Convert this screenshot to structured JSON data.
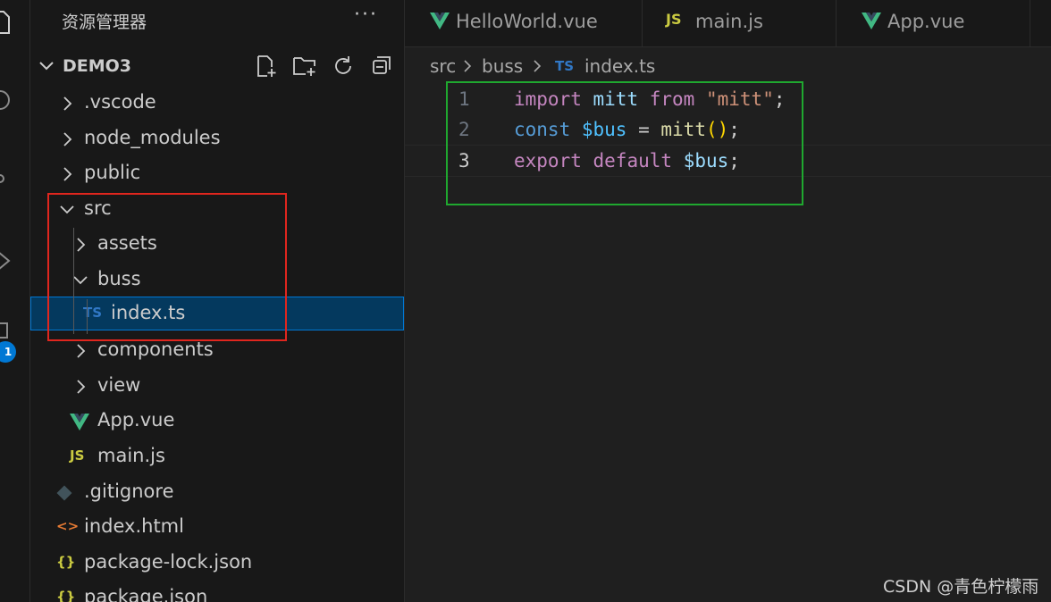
{
  "sidebar": {
    "title": "资源管理器",
    "more_icon": "ellipsis-icon",
    "section": {
      "name": "DEMO3",
      "actions": [
        "new-file-icon",
        "new-folder-icon",
        "refresh-icon",
        "collapse-all-icon"
      ]
    },
    "tree": [
      {
        "label": ".vscode",
        "type": "folder",
        "expanded": false,
        "depth": 0
      },
      {
        "label": "node_modules",
        "type": "folder",
        "expanded": false,
        "depth": 0
      },
      {
        "label": "public",
        "type": "folder",
        "expanded": false,
        "depth": 0
      },
      {
        "label": "src",
        "type": "folder",
        "expanded": true,
        "depth": 0
      },
      {
        "label": "assets",
        "type": "folder",
        "expanded": false,
        "depth": 1
      },
      {
        "label": "buss",
        "type": "folder",
        "expanded": true,
        "depth": 1
      },
      {
        "label": "index.ts",
        "type": "ts",
        "icon_text": "TS",
        "depth": 2,
        "selected": true
      },
      {
        "label": "components",
        "type": "folder",
        "expanded": false,
        "depth": 1
      },
      {
        "label": "view",
        "type": "folder",
        "expanded": false,
        "depth": 1
      },
      {
        "label": "App.vue",
        "type": "vue",
        "depth": 1
      },
      {
        "label": "main.js",
        "type": "js",
        "icon_text": "JS",
        "depth": 1
      },
      {
        "label": ".gitignore",
        "type": "git",
        "depth": 0
      },
      {
        "label": "index.html",
        "type": "html",
        "icon_text": "<>",
        "depth": 0
      },
      {
        "label": "package-lock.json",
        "type": "json",
        "icon_text": "{}",
        "depth": 0
      },
      {
        "label": "package.json",
        "type": "json",
        "icon_text": "{}",
        "depth": 0
      }
    ]
  },
  "activity_bar": {
    "icons": [
      "files-icon",
      "search-icon",
      "source-control-icon",
      "run-debug-icon",
      "extensions-icon"
    ],
    "badge": "1"
  },
  "tabs": [
    {
      "label": "HelloWorld.vue",
      "icon": "vue-icon"
    },
    {
      "label": "main.js",
      "icon": "js-icon",
      "icon_text": "JS"
    },
    {
      "label": "App.vue",
      "icon": "vue-icon"
    }
  ],
  "breadcrumb": {
    "parts": [
      "src",
      "buss"
    ],
    "file_icon_text": "TS",
    "file": "index.ts"
  },
  "editor": {
    "lines": [
      {
        "number": "1",
        "tokens": [
          [
            "import",
            "kw"
          ],
          [
            " ",
            ""
          ],
          [
            "mitt",
            "var"
          ],
          [
            " ",
            ""
          ],
          [
            "from",
            "kw"
          ],
          [
            " ",
            ""
          ],
          [
            "\"mitt\"",
            "str"
          ],
          [
            ";",
            ""
          ]
        ]
      },
      {
        "number": "2",
        "tokens": [
          [
            "const",
            "kw2"
          ],
          [
            " ",
            ""
          ],
          [
            "$bus",
            "var2"
          ],
          [
            " = ",
            ""
          ],
          [
            "mitt",
            "fn"
          ],
          [
            "()",
            "br"
          ],
          [
            ";",
            ""
          ]
        ]
      },
      {
        "number": "3",
        "tokens": [
          [
            "export",
            "kw"
          ],
          [
            " ",
            ""
          ],
          [
            "default",
            "kw"
          ],
          [
            " ",
            ""
          ],
          [
            "$bus",
            "var"
          ],
          [
            ";",
            ""
          ]
        ],
        "current": true
      }
    ]
  },
  "watermark": "CSDN @青色柠檬雨",
  "colors": {
    "annotation_red": "#e0261e",
    "annotation_green": "#1fa82f",
    "selection": "#04395e",
    "accent": "#0078d4"
  }
}
